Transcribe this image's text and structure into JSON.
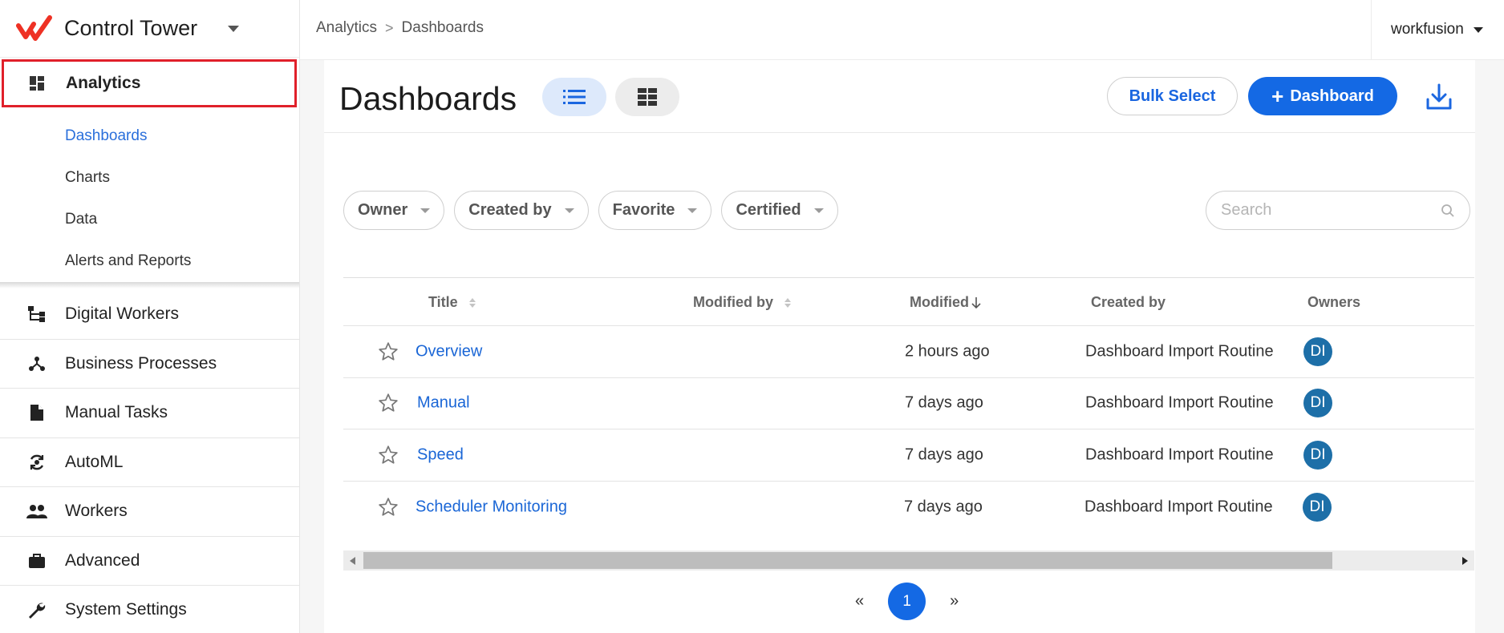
{
  "app": {
    "name": "Control Tower"
  },
  "breadcrumb": {
    "root": "Analytics",
    "separator": ">",
    "current": "Dashboards"
  },
  "user": {
    "name": "workfusion"
  },
  "sidebar": {
    "section": {
      "label": "Analytics",
      "icon": "dashboard-grid-icon"
    },
    "subitems": [
      {
        "label": "Dashboards",
        "active": true
      },
      {
        "label": "Charts"
      },
      {
        "label": "Data"
      },
      {
        "label": "Alerts and Reports"
      }
    ],
    "items": [
      {
        "label": "Digital Workers",
        "icon": "hierarchy-icon"
      },
      {
        "label": "Business Processes",
        "icon": "process-graph-icon"
      },
      {
        "label": "Manual Tasks",
        "icon": "document-icon"
      },
      {
        "label": "AutoML",
        "icon": "automl-cycle-icon"
      },
      {
        "label": "Workers",
        "icon": "people-icon"
      },
      {
        "label": "Advanced",
        "icon": "briefcase-icon"
      },
      {
        "label": "System Settings",
        "icon": "wrench-icon"
      }
    ]
  },
  "page": {
    "title": "Dashboards",
    "bulk_select_label": "Bulk Select",
    "add_label": "Dashboard",
    "add_symbol": "+"
  },
  "filters": [
    {
      "label": "Owner"
    },
    {
      "label": "Created by"
    },
    {
      "label": "Favorite"
    },
    {
      "label": "Certified"
    }
  ],
  "search": {
    "placeholder": "Search"
  },
  "table": {
    "columns": {
      "title": "Title",
      "modified_by": "Modified by",
      "modified": "Modified",
      "created_by": "Created by",
      "owners": "Owners"
    },
    "rows": [
      {
        "title": "Overview",
        "modified_by": "",
        "modified": "2 hours ago",
        "created_by": "Dashboard Import Routine",
        "owner": "DI"
      },
      {
        "title": "Manual",
        "modified_by": "",
        "modified": "7 days ago",
        "created_by": "Dashboard Import Routine",
        "owner": "DI"
      },
      {
        "title": "Speed",
        "modified_by": "",
        "modified": "7 days ago",
        "created_by": "Dashboard Import Routine",
        "owner": "DI"
      },
      {
        "title": "Scheduler Monitoring",
        "modified_by": "",
        "modified": "7 days ago",
        "created_by": "Dashboard Import Routine",
        "owner": "DI"
      }
    ]
  },
  "pagination": {
    "prev": "«",
    "current": "1",
    "next": "»"
  },
  "colors": {
    "accent": "#1469e4",
    "link": "#1a66d6",
    "brand": "#ee3124",
    "highlight_border": "#e0202a",
    "avatar": "#1d6fa8"
  }
}
